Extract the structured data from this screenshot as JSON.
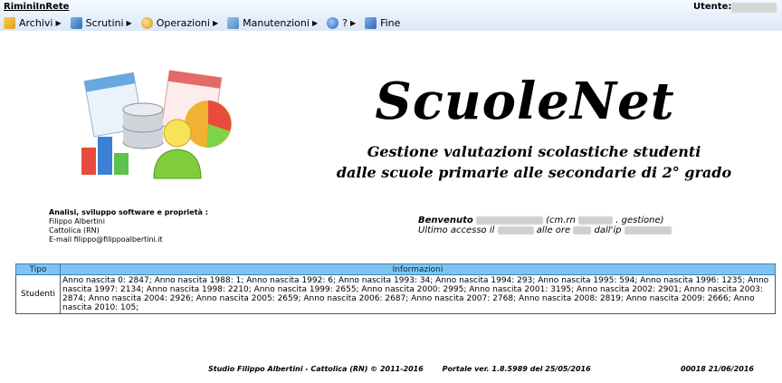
{
  "header": {
    "brand": "RiminiInRete",
    "user_label": "Utente:"
  },
  "menu": [
    {
      "label": "Archivi",
      "icon": "folder-icon"
    },
    {
      "label": "Scrutini",
      "icon": "document-icon"
    },
    {
      "label": "Operazioni",
      "icon": "gear-icon"
    },
    {
      "label": "Manutenzioni",
      "icon": "tools-icon"
    },
    {
      "label": "?",
      "icon": "help-icon"
    },
    {
      "label": "Fine",
      "icon": "exit-icon"
    }
  ],
  "main": {
    "title": "ScuoleNet",
    "subtitle1": "Gestione valutazioni scolastiche studenti",
    "subtitle2": "dalle scuole primarie alle secondarie di 2° grado"
  },
  "credits": {
    "heading": "Analisi, sviluppo software e proprietà :",
    "name": "Filippo Albertini",
    "city": "Cattolica (RN)",
    "email": "E-mail filippo@filippoalbertini.it"
  },
  "welcome": {
    "benvenuto": "Benvenuto",
    "cm": "(cm.rn",
    "gestione": ". gestione)",
    "ultimo": "Ultimo accesso il",
    "alle": "alle ore",
    "dallip": "dall'ip"
  },
  "table": {
    "headers": [
      "Tipo",
      "Informazioni"
    ],
    "rows": [
      {
        "tipo": "Studenti",
        "info": "Anno nascita 0: 2847; Anno nascita 1988: 1; Anno nascita 1992: 6; Anno nascita 1993: 34; Anno nascita 1994: 293; Anno nascita 1995: 594; Anno nascita 1996: 1235; Anno nascita 1997: 2134; Anno nascita 1998: 2210; Anno nascita 1999: 2655; Anno nascita 2000: 2995; Anno nascita 2001: 3195; Anno nascita 2002: 2901; Anno nascita 2003: 2874; Anno nascita 2004: 2926; Anno nascita 2005: 2659; Anno nascita 2006: 2687; Anno nascita 2007: 2768; Anno nascita 2008: 2819; Anno nascita 2009: 2666; Anno nascita 2010: 105;"
      }
    ]
  },
  "footer": {
    "studio": "Studio Filippo Albertini - Cattolica (RN) © 2011-2016",
    "portale": "Portale ver. 1.8.5989 del 25/05/2016",
    "right": "00018  21/06/2016"
  }
}
